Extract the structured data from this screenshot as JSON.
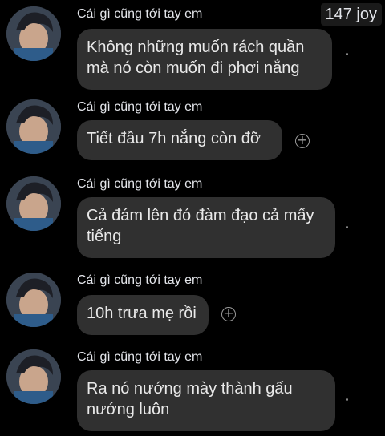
{
  "header": {
    "reaction_count": "147 joy"
  },
  "messages": [
    {
      "sender": "Cái gì cũng tới tay em",
      "text_lines": [
        "Không những muốn rách quần",
        "mà nó còn muốn đi phơi nắng"
      ],
      "accessory": "seen-dot"
    },
    {
      "sender": "Cái gì cũng tới tay em",
      "text_lines": [
        "Tiết đầu 7h nắng còn đỡ"
      ],
      "accessory": "add-reaction"
    },
    {
      "sender": "Cái gì cũng tới tay em",
      "text_lines": [
        "Cả đám lên đó đàm đạo cả mấy",
        "tiếng"
      ],
      "accessory": "seen-dot"
    },
    {
      "sender": "Cái gì cũng tới tay em",
      "text_lines": [
        "10h trưa mẹ rồi"
      ],
      "accessory": "add-reaction"
    },
    {
      "sender": "Cái gì cũng tới tay em",
      "text_lines": [
        "Ra nó nướng mày thành gấu",
        "nướng luôn"
      ],
      "accessory": "seen-dot"
    }
  ],
  "icons": {
    "add_reaction": "plus-circle-icon",
    "seen": "dot-icon"
  },
  "colors": {
    "background": "#000000",
    "bubble": "#303030",
    "text": "#e9e9e9",
    "icon": "#9a9a9a"
  }
}
